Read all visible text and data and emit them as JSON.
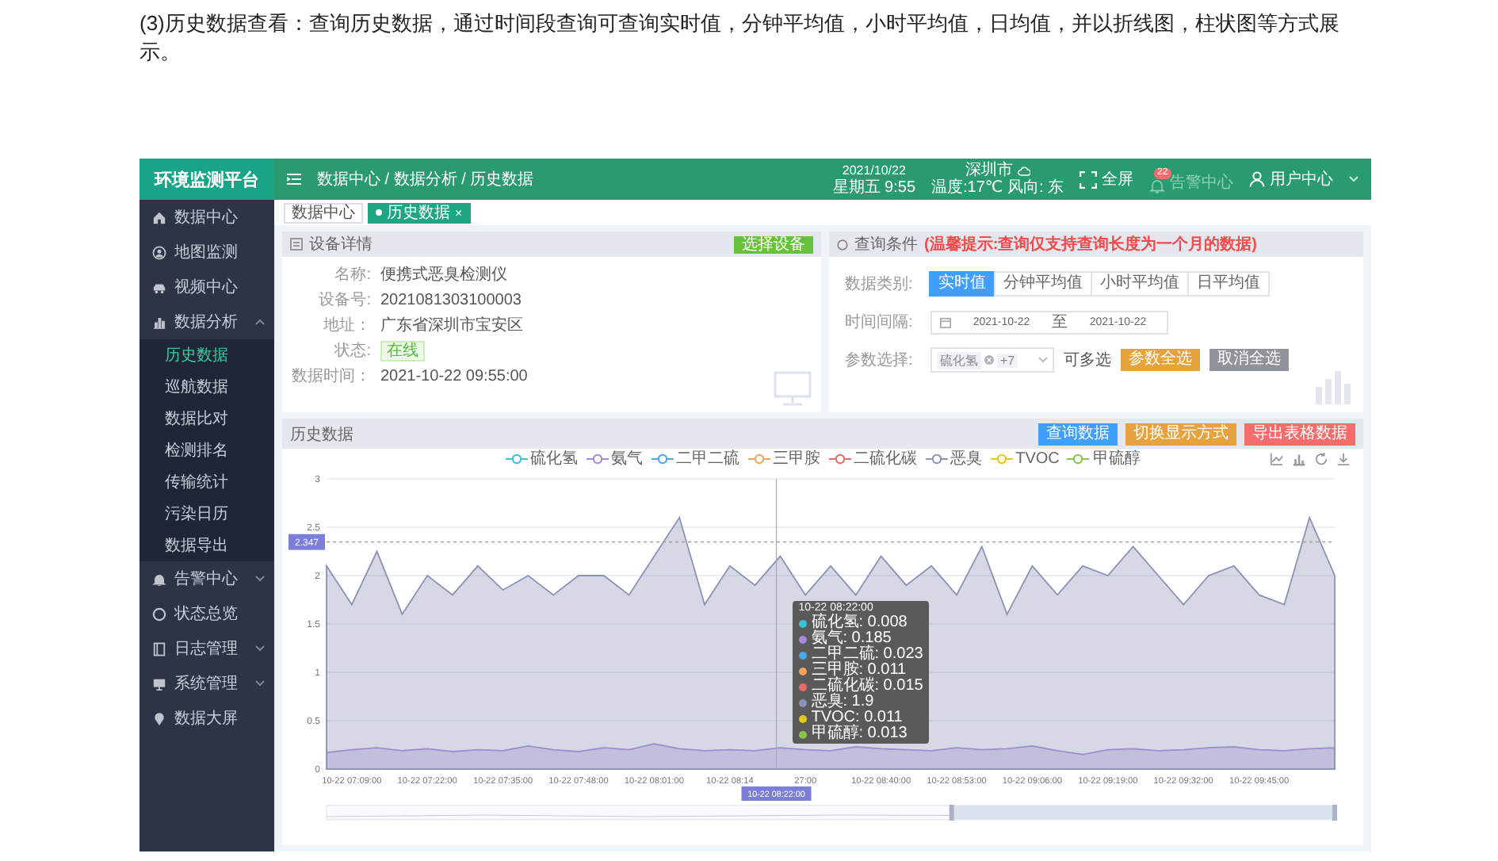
{
  "intro": "(3)历史数据查看：查询历史数据，通过时间段查询可查询实时值，分钟平均值，小时平均值，日均值，并以折线图，柱状图等方式展示。",
  "app": {
    "logo": "环境监测平台",
    "header": {
      "breadcrumb": "数据中心 / 数据分析 / 历史数据",
      "date": "2021/10/22",
      "weekday_time": "星期五 9:55",
      "city": "深圳市",
      "weather": "温度:17℃ 风向: 东",
      "fullscreen": "全屏",
      "alarm": {
        "label": "告警中心",
        "badge": "22",
        "disabled": true
      },
      "user": "用户中心"
    },
    "sidebar": {
      "items": [
        {
          "label": "数据中心",
          "selected": false
        },
        {
          "label": "地图监测",
          "selected": false
        },
        {
          "label": "视频中心",
          "selected": false
        },
        {
          "label": "数据分析",
          "selected": false,
          "expanded": true,
          "children": [
            {
              "label": "历史数据",
              "selected": true
            },
            {
              "label": "巡航数据",
              "selected": false
            },
            {
              "label": "数据比对",
              "selected": false
            },
            {
              "label": "检测排名",
              "selected": false
            },
            {
              "label": "传输统计",
              "selected": false
            },
            {
              "label": "污染日历",
              "selected": false
            },
            {
              "label": "数据导出",
              "selected": false
            }
          ]
        },
        {
          "label": "告警中心",
          "selected": false,
          "expanded": false
        },
        {
          "label": "状态总览",
          "selected": false
        },
        {
          "label": "日志管理",
          "selected": false,
          "expanded": false
        },
        {
          "label": "系统管理",
          "selected": false,
          "expanded": false
        },
        {
          "label": "数据大屏",
          "selected": false
        }
      ]
    },
    "tabs": [
      {
        "label": "数据中心",
        "selected": false
      },
      {
        "label": "历史数据",
        "selected": true,
        "close": "×"
      }
    ],
    "device": {
      "title": "设备详情",
      "button": "选择设备",
      "fields": [
        {
          "label": "名称:",
          "value": "便携式恶臭检测仪",
          "kind": "text"
        },
        {
          "label": "设备号:",
          "value": "2021081303100003",
          "kind": "text"
        },
        {
          "label": "地址：",
          "value": "广东省深圳市宝安区",
          "kind": "text"
        },
        {
          "label": "状态:",
          "value": "在线",
          "kind": "tag"
        },
        {
          "label": "数据时间：",
          "value": "2021-10-22 09:55:00",
          "kind": "text"
        }
      ]
    },
    "query": {
      "title": "查询条件",
      "notice": "(温馨提示:查询仅支持查询长度为一个月的数据)",
      "data_type": {
        "label": "数据类别:",
        "options": [
          {
            "label": "实时值",
            "selected": true
          },
          {
            "label": "分钟平均值",
            "selected": false
          },
          {
            "label": "小时平均值",
            "selected": false
          },
          {
            "label": "日平均值",
            "selected": false
          }
        ]
      },
      "time_range": {
        "label": "时间间隔:",
        "start": "2021-10-22",
        "separator": "至",
        "end": "2021-10-22"
      },
      "params": {
        "label": "参数选择:",
        "chip": "硫化氢",
        "more": "+7",
        "hint": "可多选",
        "buttons": [
          {
            "label": "参数全选",
            "kind": "warning"
          },
          {
            "label": "取消全选",
            "kind": "neutral"
          }
        ]
      }
    },
    "history": {
      "title": "历史数据",
      "buttons": [
        {
          "label": "查询数据",
          "kind": "primary"
        },
        {
          "label": "切换显示方式",
          "kind": "warning"
        },
        {
          "label": "导出表格数据",
          "kind": "danger"
        }
      ],
      "axis_pointer": {
        "x_label": "10-22 08:22:00"
      },
      "tooltip": {
        "title": "10-22 08:22:00",
        "rows": [
          "硫化氢: 0.008",
          "氨气: 0.185",
          "二甲二硫: 0.023",
          "三甲胺: 0.011",
          "二硫化碳: 0.015",
          "恶臭: 1.9",
          "TVOC: 0.011",
          "甲硫醇: 0.013"
        ]
      },
      "chart_data": {
        "type": "area",
        "ylim": [
          0,
          3
        ],
        "grid": true,
        "ref_lines": [
          {
            "axis": "y",
            "value": 2.347,
            "label": "2.347"
          }
        ],
        "categories": [
          null,
          "10-22 07:09:00",
          null,
          null,
          "10-22 07:22:00",
          null,
          null,
          "10-22 07:35:00",
          null,
          null,
          "10-22 07:48:00",
          null,
          null,
          "10-22 08:01:00",
          null,
          null,
          "10-22 08:14",
          null,
          null,
          "27:00",
          null,
          null,
          "10-22 08:40:00",
          null,
          null,
          "10-22 08:53:00",
          null,
          null,
          "10-22 09:06:00",
          null,
          null,
          "10-22 09:19:00",
          null,
          null,
          "10-22 09:32:00",
          null,
          null,
          "10-22 09:45:00",
          null,
          null,
          null
        ],
        "yticks": [
          {
            "value": 0,
            "label": "0"
          },
          {
            "value": 0.5,
            "label": "0.5"
          },
          {
            "value": 1,
            "label": "1"
          },
          {
            "value": 1.5,
            "label": "1.5"
          },
          {
            "value": 2,
            "label": "2"
          },
          {
            "value": 2.5,
            "label": "2.5"
          },
          {
            "value": 3,
            "label": "3"
          }
        ],
        "series": [
          {
            "name": "硫化氢",
            "color": "#37c3d6",
            "values": [
              null,
              null,
              null,
              null,
              null,
              null,
              null,
              null,
              null,
              null,
              null,
              null,
              null,
              null,
              null,
              null,
              null,
              null,
              null,
              null,
              null,
              null,
              null,
              null,
              null,
              null,
              null,
              null,
              null,
              null,
              null,
              null,
              null,
              null,
              null,
              null,
              null,
              null,
              null,
              null,
              null
            ]
          },
          {
            "name": "氨气",
            "color": "#a78bdb",
            "values": [
              0.17,
              0.2,
              0.22,
              0.19,
              0.21,
              0.18,
              0.2,
              0.19,
              0.24,
              0.2,
              0.18,
              0.22,
              0.2,
              0.26,
              0.21,
              0.19,
              0.2,
              0.19,
              0.22,
              0.2,
              0.19,
              0.23,
              0.21,
              0.2,
              0.19,
              0.22,
              0.2,
              0.21,
              0.24,
              0.19,
              0.15,
              0.2,
              0.21,
              0.19,
              0.2,
              0.22,
              0.23,
              0.2,
              0.19,
              0.21,
              0.22
            ]
          },
          {
            "name": "二甲二硫",
            "color": "#4aa8e8",
            "values": [
              null,
              null,
              null,
              null,
              null,
              null,
              null,
              null,
              null,
              null,
              null,
              null,
              null,
              null,
              null,
              null,
              null,
              null,
              null,
              null,
              null,
              null,
              null,
              null,
              null,
              null,
              null,
              null,
              null,
              null,
              null,
              null,
              null,
              null,
              null,
              null,
              null,
              null,
              null,
              null,
              null
            ]
          },
          {
            "name": "三甲胺",
            "color": "#f5a35c",
            "values": [
              null,
              null,
              null,
              null,
              null,
              null,
              null,
              null,
              null,
              null,
              null,
              null,
              null,
              null,
              null,
              null,
              null,
              null,
              null,
              null,
              null,
              null,
              null,
              null,
              null,
              null,
              null,
              null,
              null,
              null,
              null,
              null,
              null,
              null,
              null,
              null,
              null,
              null,
              null,
              null,
              null
            ]
          },
          {
            "name": "二硫化碳",
            "color": "#e86b6b",
            "values": [
              null,
              null,
              null,
              null,
              null,
              null,
              null,
              null,
              null,
              null,
              null,
              null,
              null,
              null,
              null,
              null,
              null,
              null,
              null,
              null,
              null,
              null,
              null,
              null,
              null,
              null,
              null,
              null,
              null,
              null,
              null,
              null,
              null,
              null,
              null,
              null,
              null,
              null,
              null,
              null,
              null
            ]
          },
          {
            "name": "恶臭",
            "color": "#8a93b5",
            "values": [
              2.1,
              1.7,
              2.25,
              1.6,
              2.0,
              1.8,
              2.1,
              1.85,
              2.0,
              1.8,
              2.0,
              2.0,
              1.8,
              2.2,
              2.6,
              1.7,
              2.1,
              1.9,
              2.2,
              1.8,
              2.1,
              1.8,
              2.2,
              1.9,
              2.1,
              1.8,
              2.3,
              1.6,
              2.1,
              1.8,
              2.1,
              2.0,
              2.3,
              2.0,
              1.7,
              2.0,
              2.1,
              1.8,
              1.7,
              2.6,
              2.0
            ]
          },
          {
            "name": "TVOC",
            "color": "#e6c619",
            "values": [
              null,
              null,
              null,
              null,
              null,
              null,
              null,
              null,
              null,
              null,
              null,
              null,
              null,
              null,
              null,
              null,
              null,
              null,
              null,
              null,
              null,
              null,
              null,
              null,
              null,
              null,
              null,
              null,
              null,
              null,
              null,
              null,
              null,
              null,
              null,
              null,
              null,
              null,
              null,
              null,
              null
            ]
          },
          {
            "name": "甲硫醇",
            "color": "#8bc34a",
            "values": [
              null,
              null,
              null,
              null,
              null,
              null,
              null,
              null,
              null,
              null,
              null,
              null,
              null,
              null,
              null,
              null,
              null,
              null,
              null,
              null,
              null,
              null,
              null,
              null,
              null,
              null,
              null,
              null,
              null,
              null,
              null,
              null,
              null,
              null,
              null,
              null,
              null,
              null,
              null,
              null,
              null
            ]
          }
        ]
      }
    }
  }
}
